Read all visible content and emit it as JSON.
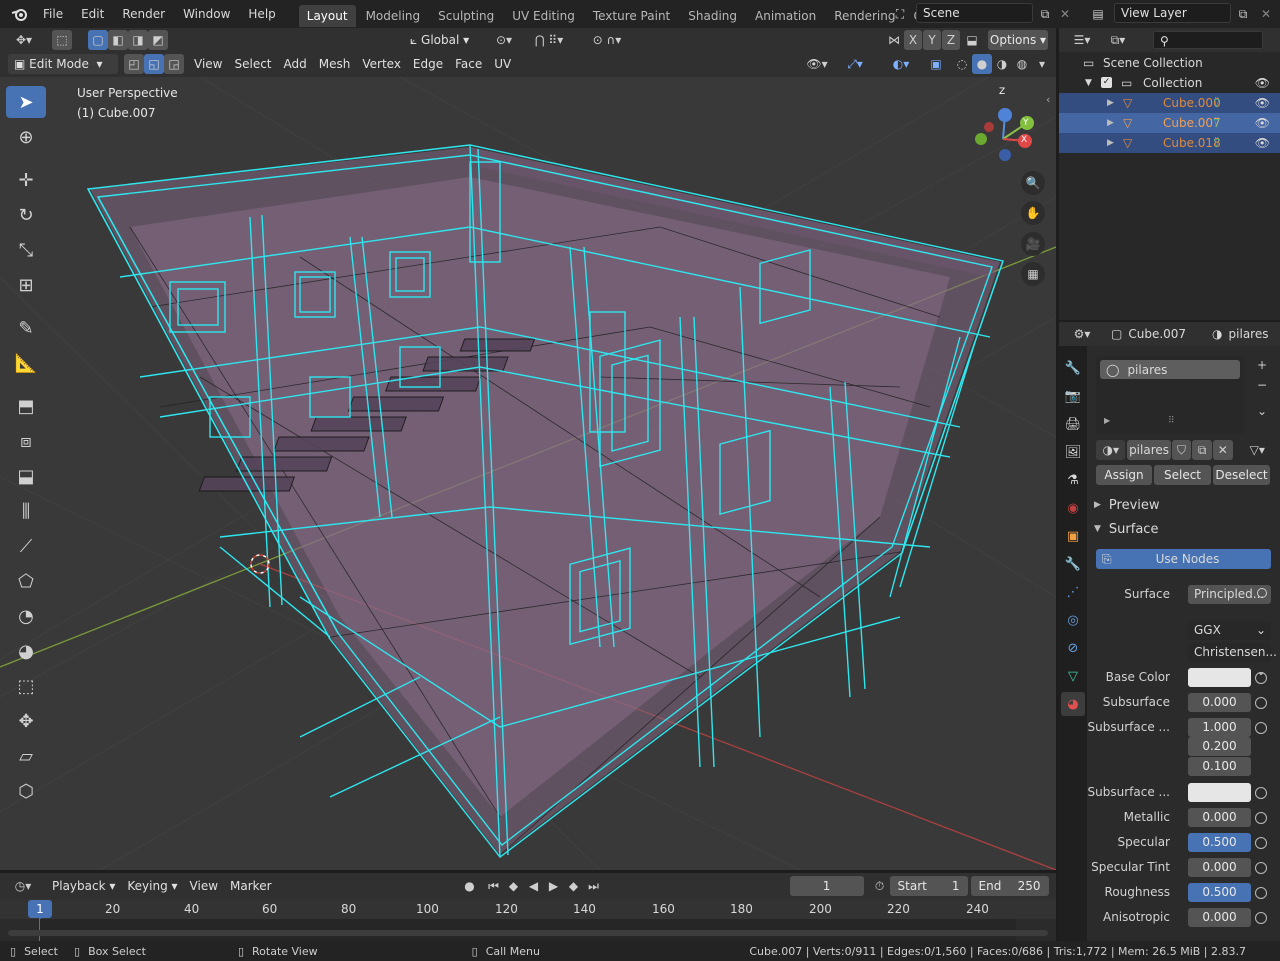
{
  "topbar": {
    "menus": [
      "File",
      "Edit",
      "Render",
      "Window",
      "Help"
    ],
    "workspaces": [
      "Layout",
      "Modeling",
      "Sculpting",
      "UV Editing",
      "Texture Paint",
      "Shading",
      "Animation",
      "Rendering",
      "Compositing"
    ],
    "active_workspace": "Layout",
    "scene_name": "Scene",
    "view_layer": "View Layer"
  },
  "viewport_header": {
    "orientation": "Global",
    "options_label": "Options",
    "axes": [
      "X",
      "Y",
      "Z"
    ],
    "mode": "Edit Mode",
    "menus": [
      "View",
      "Select",
      "Add",
      "Mesh",
      "Vertex",
      "Edge",
      "Face",
      "UV"
    ]
  },
  "viewport": {
    "perspective_label": "User Perspective",
    "object_label": "(1) Cube.007",
    "gizmo_axes": [
      "X",
      "Y",
      "Z"
    ]
  },
  "outliner": {
    "scene_collection": "Scene Collection",
    "collection": "Collection",
    "objects": [
      "Cube.000",
      "Cube.007",
      "Cube.018"
    ]
  },
  "properties": {
    "object_name": "Cube.007",
    "material_name": "pilares",
    "slot_name": "pilares",
    "assign": "Assign",
    "select": "Select",
    "deselect": "Deselect",
    "preview": "Preview",
    "surface_section": "Surface",
    "use_nodes": "Use Nodes",
    "surface_label": "Surface",
    "surface_value": "Principled...",
    "distribution": "GGX",
    "subsurface_method": "Christensen...",
    "fields": {
      "base_color": "Base Color",
      "subsurface": "Subsurface",
      "subsurface_value": "0.000",
      "subsurface_radius": "Subsurface ...",
      "radius_1": "1.000",
      "radius_2": "0.200",
      "radius_3": "0.100",
      "subsurface_color": "Subsurface ...",
      "metallic": "Metallic",
      "metallic_value": "0.000",
      "specular": "Specular",
      "specular_value": "0.500",
      "specular_tint": "Specular Tint",
      "specular_tint_value": "0.000",
      "roughness": "Roughness",
      "roughness_value": "0.500",
      "anisotropic": "Anisotropic",
      "anisotropic_value": "0.000"
    }
  },
  "timeline": {
    "menus": [
      "Playback",
      "Keying",
      "View",
      "Marker"
    ],
    "current_frame": "1",
    "start_label": "Start",
    "start_value": "1",
    "end_label": "End",
    "end_value": "250",
    "ticks": [
      "20",
      "40",
      "60",
      "80",
      "100",
      "120",
      "140",
      "160",
      "180",
      "200",
      "220",
      "240"
    ],
    "frame_indicator": "1"
  },
  "statusbar": {
    "select": "Select",
    "box_select": "Box Select",
    "rotate_view": "Rotate View",
    "call_menu": "Call Menu",
    "stats": "Cube.007 | Verts:0/911 | Edges:0/1,560 | Faces:0/686 | Tris:1,772 | Mem: 26.5 MiB | 2.83.7"
  },
  "colors": {
    "accent": "#4772b3",
    "wire": "#2ee6ee",
    "face": "#8a6f86",
    "selected_object_text": "#e08a3c"
  }
}
